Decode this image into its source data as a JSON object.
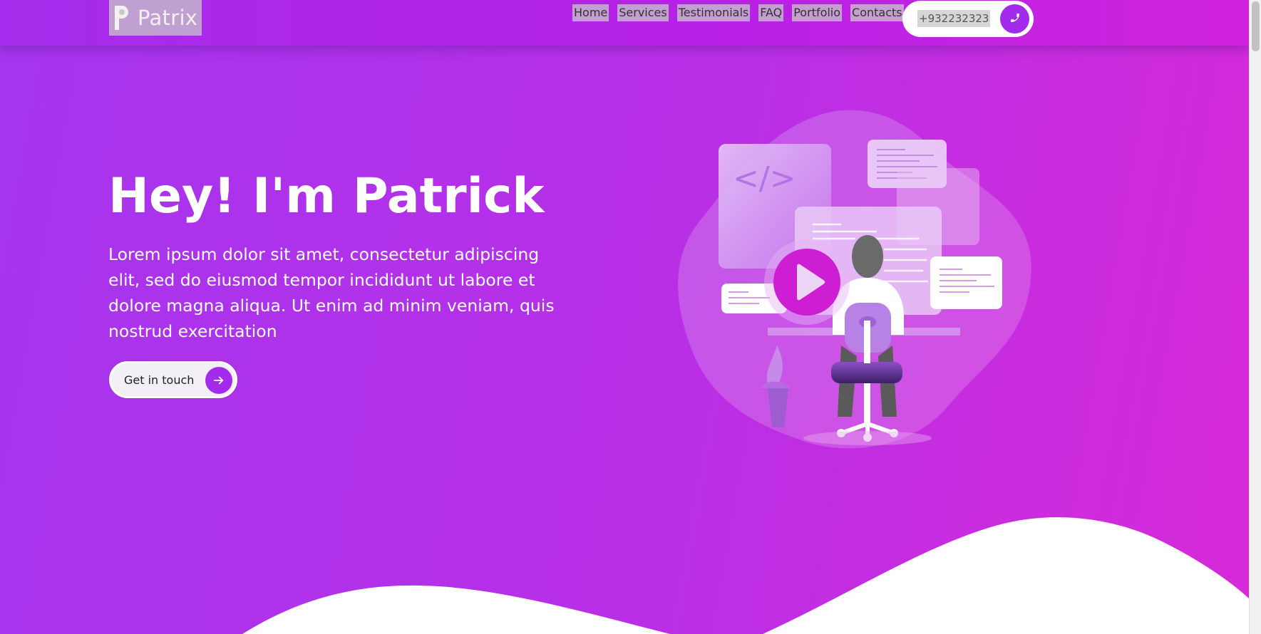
{
  "brand": {
    "name": "Patrix",
    "logo_icon": "p-logo-icon"
  },
  "nav": {
    "links": [
      {
        "label": "Home"
      },
      {
        "label": "Services"
      },
      {
        "label": "Testimonials"
      },
      {
        "label": "FAQ"
      },
      {
        "label": "Portfolio"
      },
      {
        "label": "Contacts"
      }
    ],
    "phone": "+932232323",
    "phone_icon": "phone-icon"
  },
  "hero": {
    "title": "Hey! I'm Patrick",
    "text": "Lorem ipsum dolor sit amet, consectetur adipiscing elit, sed do eiusmod tempor incididunt ut labore et dolore magna aliqua. Ut enim ad minim veniam, quis nostrud exercitation",
    "cta_label": "Get in touch",
    "cta_icon": "arrow-right-icon",
    "illustration": {
      "code_symbol": "</>",
      "play_icon": "play-icon"
    }
  },
  "colors": {
    "gradient_start": "#a535ee",
    "gradient_end": "#d72ad8",
    "accent": "#a22bec",
    "white": "#ffffff"
  }
}
